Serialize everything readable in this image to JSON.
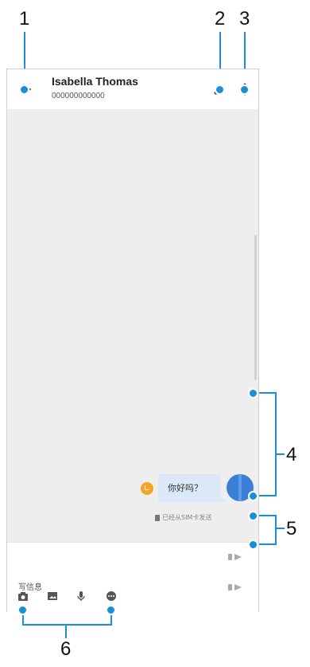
{
  "callouts": {
    "c1": "1",
    "c2": "2",
    "c3": "3",
    "c4": "4",
    "c5": "5",
    "c6": "6"
  },
  "header": {
    "contact_name": "Isabella Thomas",
    "contact_number": "000000000000"
  },
  "thread": {
    "message_text": "你好吗？",
    "sim_status": "已经从SIM卡发送"
  },
  "composer": {
    "placeholder": "写信息"
  },
  "icons": {
    "back": "back-arrow-icon",
    "call": "phone-icon",
    "more": "more-vert-icon",
    "camera": "camera-icon",
    "gallery": "image-icon",
    "mic": "microphone-icon",
    "emoji": "more-options-icon",
    "send": "send-icon"
  },
  "colors": {
    "accent": "#1a8fd8",
    "bubble": "#dbe8f7",
    "avatar": "#3a7fd5",
    "pending": "#f5a623"
  }
}
